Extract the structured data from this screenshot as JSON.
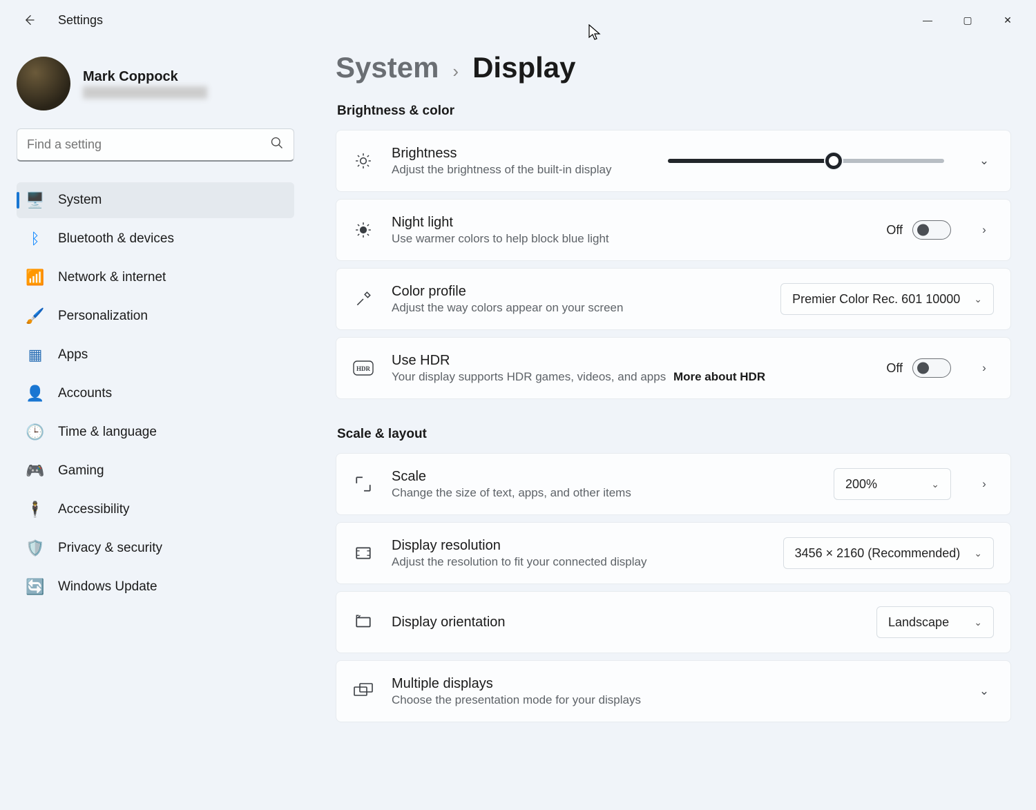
{
  "app_title": "Settings",
  "window_controls": {
    "min": "—",
    "max": "▢",
    "close": "✕"
  },
  "user": {
    "name": "Mark Coppock",
    "email": ""
  },
  "search": {
    "placeholder": "Find a setting"
  },
  "nav": [
    {
      "label": "System",
      "active": true,
      "icon": "🖥️"
    },
    {
      "label": "Bluetooth & devices",
      "icon": "ᛒ",
      "color": "#0a84ff"
    },
    {
      "label": "Network & internet",
      "icon": "📶",
      "color": "#0a84ff"
    },
    {
      "label": "Personalization",
      "icon": "🖌️"
    },
    {
      "label": "Apps",
      "icon": "▦",
      "color": "#2a6fb5"
    },
    {
      "label": "Accounts",
      "icon": "👤",
      "color": "#19a86b"
    },
    {
      "label": "Time & language",
      "icon": "🕒",
      "color": "#1e88c7"
    },
    {
      "label": "Gaming",
      "icon": "🎮",
      "color": "#888"
    },
    {
      "label": "Accessibility",
      "icon": "🕴️",
      "color": "#0a84ff"
    },
    {
      "label": "Privacy & security",
      "icon": "🛡️",
      "color": "#9aa0a6"
    },
    {
      "label": "Windows Update",
      "icon": "🔄",
      "color": "#0a84ff"
    }
  ],
  "breadcrumb": {
    "parent": "System",
    "current": "Display"
  },
  "groups": {
    "brightness_color": {
      "heading": "Brightness & color",
      "brightness": {
        "title": "Brightness",
        "sub": "Adjust the brightness of the built-in display",
        "value_pct": 60
      },
      "night_light": {
        "title": "Night light",
        "sub": "Use warmer colors to help block blue light",
        "state": "Off"
      },
      "color_profile": {
        "title": "Color profile",
        "sub": "Adjust the way colors appear on your screen",
        "selected": "Premier Color Rec. 601 10000"
      },
      "hdr": {
        "title": "Use HDR",
        "sub": "Your display supports HDR games, videos, and apps",
        "link": "More about HDR",
        "state": "Off"
      }
    },
    "scale_layout": {
      "heading": "Scale & layout",
      "scale": {
        "title": "Scale",
        "sub": "Change the size of text, apps, and other items",
        "selected": "200%"
      },
      "resolution": {
        "title": "Display resolution",
        "sub": "Adjust the resolution to fit your connected display",
        "selected": "3456 × 2160 (Recommended)"
      },
      "orientation": {
        "title": "Display orientation",
        "selected": "Landscape"
      },
      "multiple": {
        "title": "Multiple displays",
        "sub": "Choose the presentation mode for your displays"
      }
    }
  }
}
